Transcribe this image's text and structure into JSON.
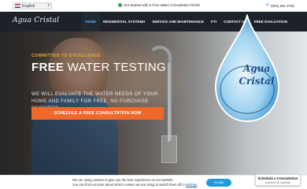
{
  "topbar": {
    "language": "English",
    "announcement": "Get Started with a Free Water Consultation NOW!",
    "phone": "(954) 261-4752"
  },
  "brand": {
    "logo_text": "Agua Cristal"
  },
  "nav": {
    "items": [
      {
        "label": "HOME",
        "active": true
      },
      {
        "label": "RESIDENTIAL SYSTEMS"
      },
      {
        "label": "SERVICE AND MAINTENANCE"
      },
      {
        "label": "FYI"
      },
      {
        "label": "CONTACT US"
      },
      {
        "label": "FREE EVALUATION"
      }
    ],
    "active_color": "#5fb6ff"
  },
  "hero": {
    "eyebrow": "COMMITTED TO EXCELLENCE",
    "headline_bold": "FREE",
    "headline_rest": " WATER TESTING",
    "subtext": "WE WILL EVALUATE THE WATER NEEDS OF YOUR HOME AND FAMILY FOR FREE, NO PURCHASE REQUIRED",
    "cta_label": "SCHEDULE A FREE CONSULTATION NOW",
    "cta_color": "#f0682a"
  },
  "drop_logo": {
    "line1": "Agua",
    "line2": "Cristal",
    "color": "#1d4f8a"
  },
  "cookie": {
    "text_line1": "We are using cookies to give you the best experience on our website.",
    "text_line2_prefix": "You can find out more about which cookies we are using or switch them off in ",
    "settings_link": "settings",
    "button": "Accept"
  },
  "calendly": {
    "title": "Schedule a Consultation",
    "powered": "powered by Calendly"
  }
}
